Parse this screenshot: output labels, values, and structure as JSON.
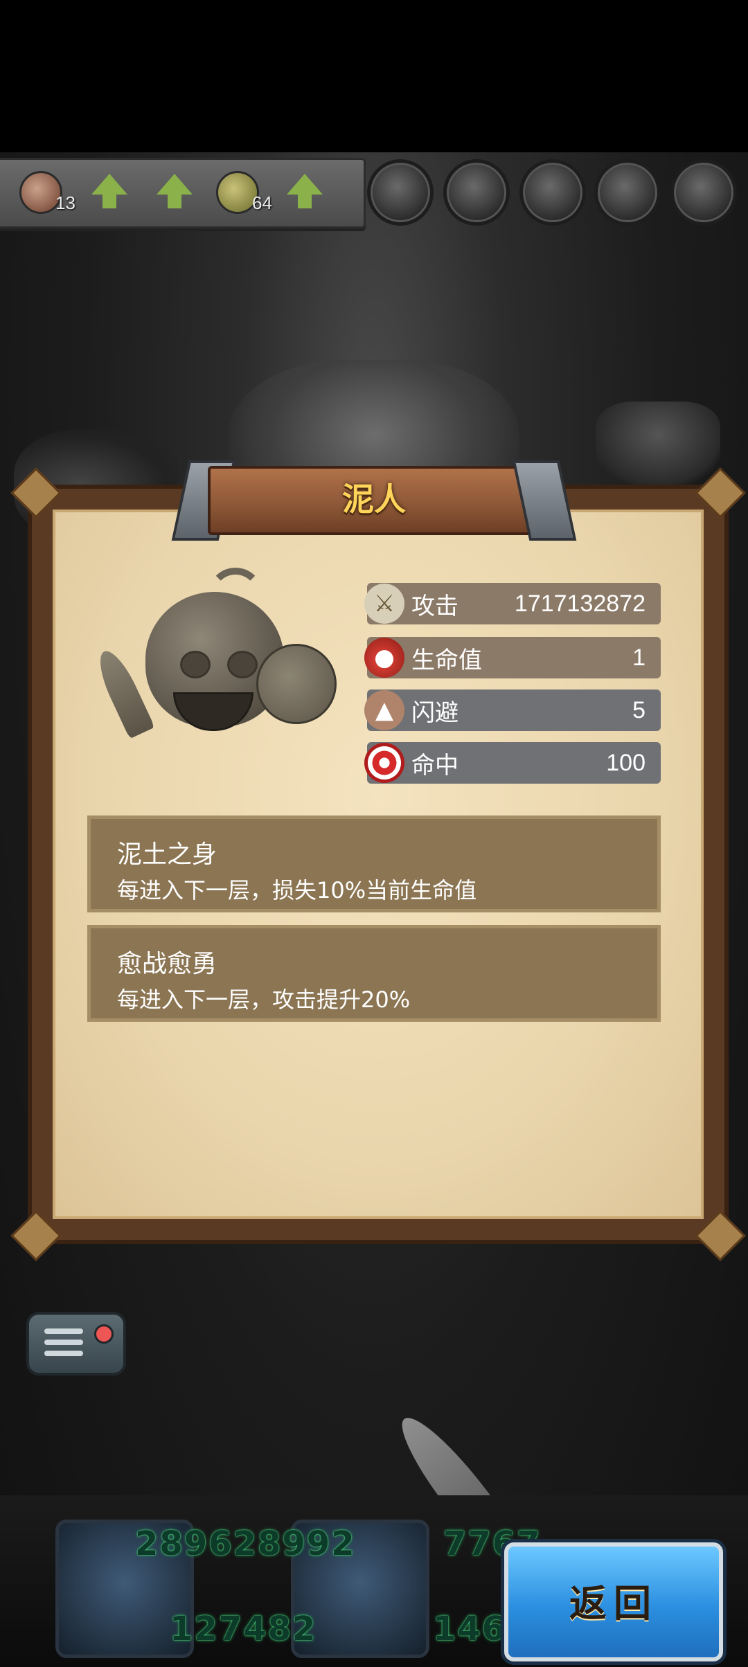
{
  "top_bar": {
    "items": [
      {
        "icon": "attack-badge-icon",
        "count": "13"
      },
      {
        "icon": "up-arrow-icon"
      },
      {
        "icon": "up-arrow-icon"
      },
      {
        "icon": "laurel-badge-icon",
        "count": "64"
      },
      {
        "icon": "up-arrow-icon"
      }
    ],
    "slots": [
      "armor-slot-icon",
      "chest-slot-icon",
      "helmet-slot-icon",
      "mask-slot-icon",
      "face-slot-icon"
    ]
  },
  "monster": {
    "name": "泥人",
    "stats": [
      {
        "icon": "sword-icon",
        "label": "攻击",
        "value": "1717132872"
      },
      {
        "icon": "potion-icon",
        "label": "生命值",
        "value": "1"
      },
      {
        "icon": "boot-icon",
        "label": "闪避",
        "value": "5"
      },
      {
        "icon": "target-icon",
        "label": "命中",
        "value": "100"
      }
    ],
    "skills": [
      {
        "name": "泥土之身",
        "desc": "每进入下一层，损失10%当前生命值"
      },
      {
        "name": "愈战愈勇",
        "desc": "每进入下一层，攻击提升20%"
      }
    ]
  },
  "bottom": {
    "hero_values": [
      "289628992",
      "7767",
      "127482",
      "146"
    ],
    "return_label": "返回"
  }
}
